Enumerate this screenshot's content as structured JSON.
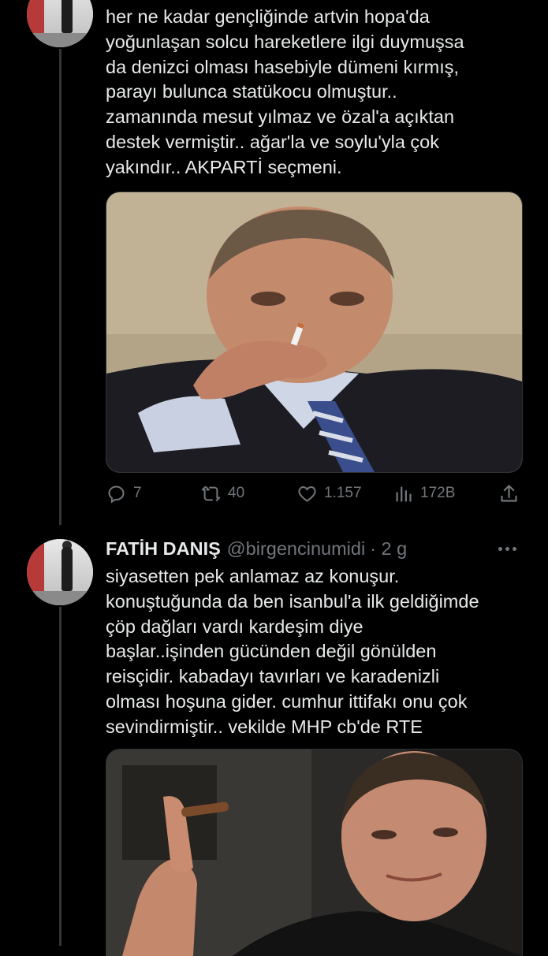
{
  "tweet1": {
    "text": "her ne kadar gençliğinde artvin hopa'da\nyoğunlaşan solcu hareketlere ilgi duymuşsa\nda denizci olması hasebiyle dümeni kırmış,\nparayı bulunca statükocu olmuştur..\nzamanında mesut yılmaz ve özal'a açıktan\ndestek vermiştir.. ağar'la ve soylu'yla çok\nyakındır.. AKPARTİ seçmeni.",
    "media_icon": "photo-man-smoking-in-suit",
    "actions": {
      "reply_count": "7",
      "retweet_count": "40",
      "like_count": "1.157",
      "views_count": "172B"
    }
  },
  "tweet2": {
    "author_name": "FATİH DANIŞ",
    "author_handle": "@birgencinumidi",
    "time": "· 2 g",
    "text": "siyasetten pek anlamaz az konuşur.\nkonuştuğunda da ben isanbul'a ilk geldiğimde\nçöp dağları vardı kardeşim diye\nbaşlar..işinden gücünden değil gönülden\nreisçidir. kabadayı tavırları ve karadenizli\nolması hoşuna gider. cumhur ittifakı onu çok\nsevindirmiştir.. vekilde MHP cb'de RTE",
    "media_icon": "photo-man-holding-cigar"
  },
  "colors": {
    "background": "#000000",
    "text": "#e7e9ea",
    "muted": "#71767b",
    "thread_line": "#333639"
  }
}
